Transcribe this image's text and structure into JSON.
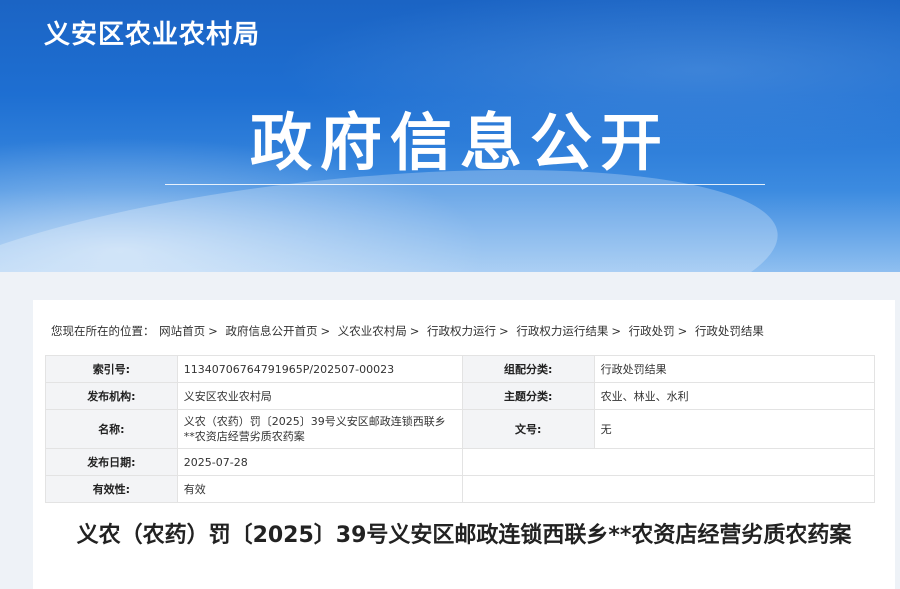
{
  "header": {
    "site_name": "义安区农业农村局",
    "banner_title": "政府信息公开"
  },
  "breadcrumb": {
    "prefix": "您现在所在的位置：",
    "items": [
      "网站首页",
      "政府信息公开首页",
      "义农业农村局",
      "行政权力运行",
      "行政权力运行结果",
      "行政处罚",
      "行政处罚结果"
    ],
    "separator": ">"
  },
  "meta": {
    "index_label": "索引号:",
    "index_value": "11340706764791965P/202507-00023",
    "category_label": "组配分类:",
    "category_value": "行政处罚结果",
    "publisher_label": "发布机构:",
    "publisher_value": "义安区农业农村局",
    "topic_label": "主题分类:",
    "topic_value": "农业、林业、水利",
    "name_label": "名称:",
    "name_value": "义农（农药）罚〔2025〕39号义安区邮政连锁西联乡**农资店经营劣质农药案",
    "docno_label": "文号:",
    "docno_value": "无",
    "date_label": "发布日期:",
    "date_value": "2025-07-28",
    "validity_label": "有效性:",
    "validity_value": "有效"
  },
  "document": {
    "title": "义农（农药）罚〔2025〕39号义安区邮政连锁西联乡**农资店经营劣质农药案"
  }
}
